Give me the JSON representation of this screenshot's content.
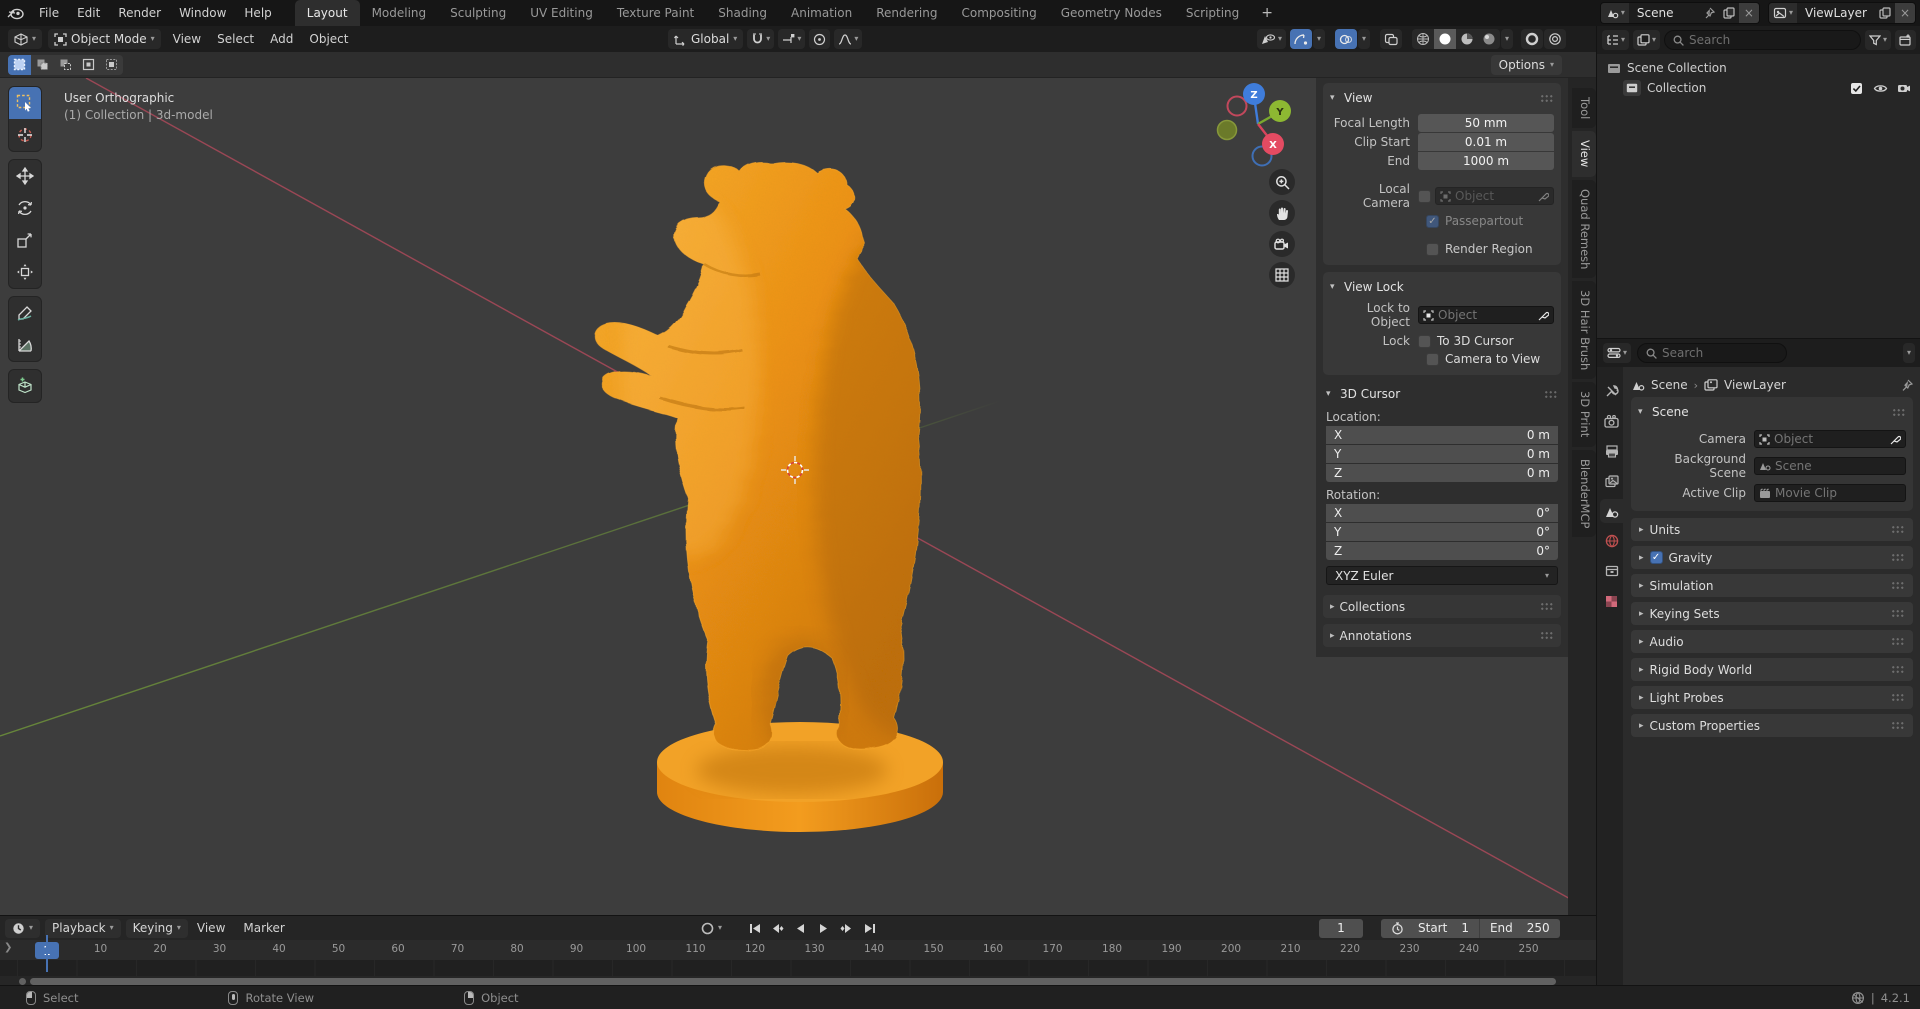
{
  "colors": {
    "accent": "#4772b3",
    "object_orange": "#ed8e14",
    "axis_x": "#c94b5e",
    "axis_y": "#6b8e3a",
    "axis_z": "#3f7ddb"
  },
  "topbar": {
    "menus": [
      "File",
      "Edit",
      "Render",
      "Window",
      "Help"
    ],
    "tabs": [
      {
        "label": "Layout",
        "active": true
      },
      {
        "label": "Modeling"
      },
      {
        "label": "Sculpting"
      },
      {
        "label": "UV Editing"
      },
      {
        "label": "Texture Paint"
      },
      {
        "label": "Shading"
      },
      {
        "label": "Animation"
      },
      {
        "label": "Rendering"
      },
      {
        "label": "Compositing"
      },
      {
        "label": "Geometry Nodes"
      },
      {
        "label": "Scripting"
      }
    ],
    "new_tab": "+",
    "scene_name": "Scene",
    "viewlayer_name": "ViewLayer"
  },
  "viewport_header": {
    "mode": "Object Mode",
    "menus": [
      "View",
      "Select",
      "Add",
      "Object"
    ],
    "orientation": "Global",
    "options_label": "Options"
  },
  "viewport": {
    "overlay_line1": "User Orthographic",
    "overlay_line2": "(1) Collection | 3d-model",
    "gizmo": {
      "x": "X",
      "y": "Y",
      "z": "Z"
    }
  },
  "npanel": {
    "tabs": [
      {
        "label": "Tool"
      },
      {
        "label": "View",
        "active": true
      },
      {
        "label": "Quad Remesh"
      },
      {
        "label": "3D Hair Brush"
      },
      {
        "label": "3D Print"
      },
      {
        "label": "BlenderMCP"
      }
    ],
    "view": {
      "title": "View",
      "focal_length_label": "Focal Length",
      "focal_length": "50 mm",
      "clip_start_label": "Clip Start",
      "clip_start": "0.01 m",
      "end_label": "End",
      "end": "1000 m",
      "local_camera_label": "Local Camera",
      "object_placeholder": "Object",
      "passepartout_label": "Passepartout",
      "render_region_label": "Render Region"
    },
    "view_lock": {
      "title": "View Lock",
      "lock_to_object_label": "Lock to Object",
      "object_placeholder": "Object",
      "lock_label": "Lock",
      "to_3d_cursor_label": "To 3D Cursor",
      "camera_to_view_label": "Camera to View"
    },
    "cursor3d": {
      "title": "3D Cursor",
      "location_label": "Location:",
      "rotation_label": "Rotation:",
      "location": [
        {
          "axis": "X",
          "value": "0 m"
        },
        {
          "axis": "Y",
          "value": "0 m"
        },
        {
          "axis": "Z",
          "value": "0 m"
        }
      ],
      "rotation": [
        {
          "axis": "X",
          "value": "0°"
        },
        {
          "axis": "Y",
          "value": "0°"
        },
        {
          "axis": "Z",
          "value": "0°"
        }
      ],
      "euler": "XYZ Euler"
    },
    "collections_label": "Collections",
    "annotations_label": "Annotations"
  },
  "outliner": {
    "search_placeholder": "Search",
    "scene_collection": "Scene Collection",
    "collection": "Collection"
  },
  "properties": {
    "search_placeholder": "Search",
    "breadcrumb_scene": "Scene",
    "breadcrumb_viewlayer": "ViewLayer",
    "scene_panel": {
      "title": "Scene",
      "camera_label": "Camera",
      "camera_value": "Object",
      "background_label": "Background Scene",
      "background_value": "Scene",
      "clip_label": "Active Clip",
      "clip_value": "Movie Clip"
    },
    "sections": [
      {
        "label": "Units"
      },
      {
        "label": "Gravity",
        "checkbox": true,
        "checked": true
      },
      {
        "label": "Simulation"
      },
      {
        "label": "Keying Sets"
      },
      {
        "label": "Audio"
      },
      {
        "label": "Rigid Body World"
      },
      {
        "label": "Light Probes"
      },
      {
        "label": "Custom Properties"
      }
    ]
  },
  "timeline": {
    "menus": [
      {
        "label": "Playback",
        "dropdown": true
      },
      {
        "label": "Keying",
        "dropdown": true
      },
      {
        "label": "View"
      },
      {
        "label": "Marker"
      }
    ],
    "frame_current": "1",
    "playhead": "1",
    "start_label": "Start",
    "start": "1",
    "end_label": "End",
    "end": "250",
    "ticks": [
      "1",
      "10",
      "20",
      "30",
      "40",
      "50",
      "60",
      "70",
      "80",
      "90",
      "100",
      "110",
      "120",
      "130",
      "140",
      "150",
      "160",
      "170",
      "180",
      "190",
      "200",
      "210",
      "220",
      "230",
      "240",
      "250"
    ]
  },
  "statusbar": {
    "hints": [
      {
        "left": true,
        "label": "Select"
      },
      {
        "middle": true,
        "label": "Rotate View"
      },
      {
        "right": true,
        "label": "Object"
      }
    ],
    "version": "4.2.1"
  }
}
